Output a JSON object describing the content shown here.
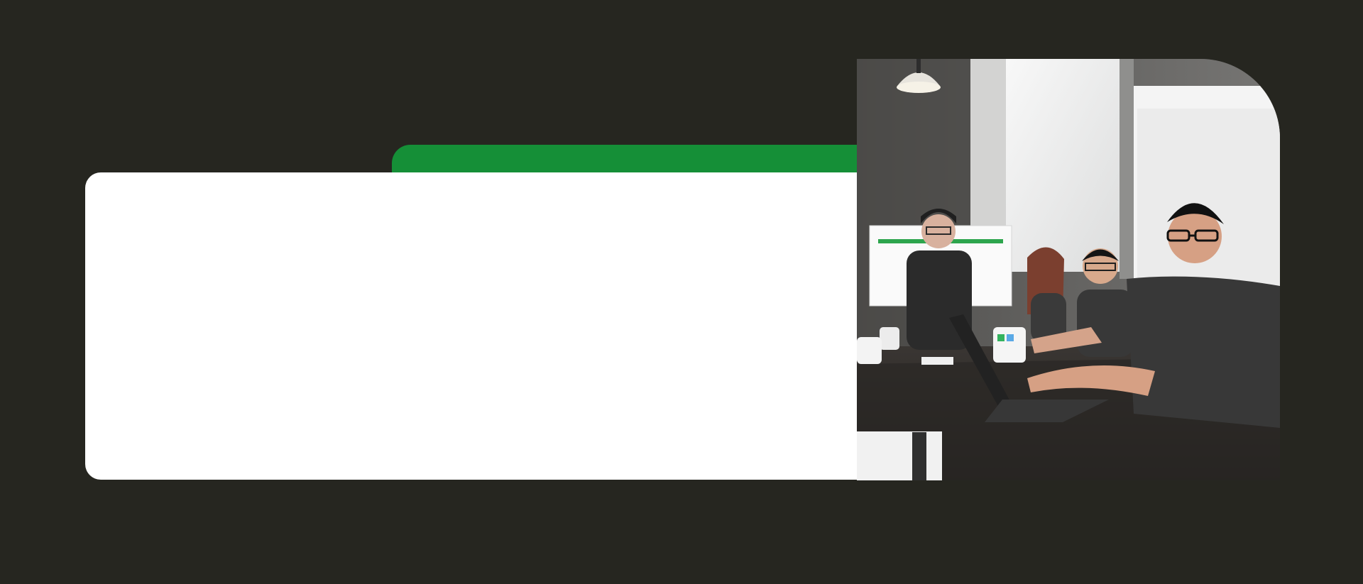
{
  "page": {
    "background": "#262620"
  },
  "accent": {
    "green": "#158f37",
    "card": "#ffffff"
  },
  "photo": {
    "icon": "team-meeting-photo",
    "whiteboard_title": "",
    "mug_text": ""
  }
}
